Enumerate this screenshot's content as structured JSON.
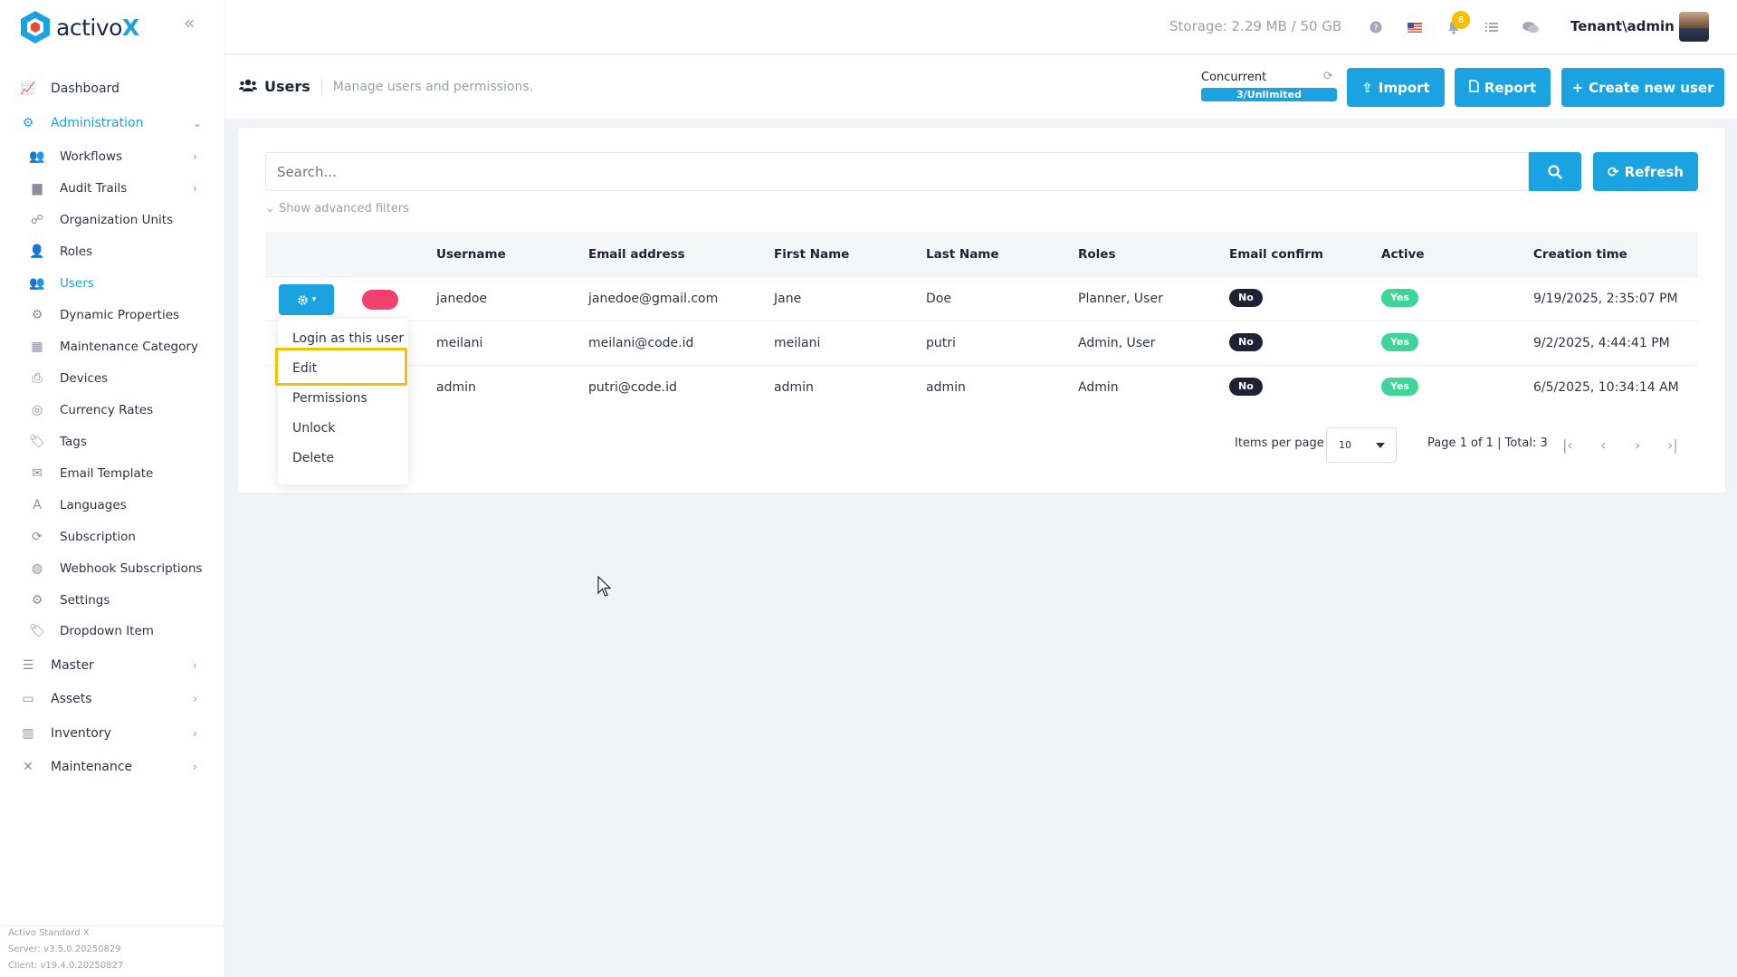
{
  "brand": {
    "name_prefix": "activo",
    "name_suffix": "X",
    "accent": "#1aa3e0"
  },
  "sidebar": {
    "items": [
      {
        "label": "Dashboard",
        "icon": "chart-line-icon",
        "level": "top",
        "active": false,
        "chevron": false
      },
      {
        "label": "Administration",
        "icon": "cogs-icon",
        "level": "top",
        "active": true,
        "chevron": "down"
      },
      {
        "label": "Workflows",
        "icon": "users-icon",
        "level": "sub",
        "active": false,
        "chevron": "right"
      },
      {
        "label": "Audit Trails",
        "icon": "folder-icon",
        "level": "sub",
        "active": false,
        "chevron": "right"
      },
      {
        "label": "Organization Units",
        "icon": "sitemap-icon",
        "level": "sub",
        "active": false,
        "chevron": false
      },
      {
        "label": "Roles",
        "icon": "user-tag-icon",
        "level": "sub",
        "active": false,
        "chevron": false
      },
      {
        "label": "Users",
        "icon": "users-icon",
        "level": "sub",
        "active": true,
        "chevron": false
      },
      {
        "label": "Dynamic Properties",
        "icon": "gear-icon",
        "level": "sub",
        "active": false,
        "chevron": false
      },
      {
        "label": "Maintenance Category",
        "icon": "grid-icon",
        "level": "sub",
        "active": false,
        "chevron": false
      },
      {
        "label": "Devices",
        "icon": "printer-icon",
        "level": "sub",
        "active": false,
        "chevron": false
      },
      {
        "label": "Currency Rates",
        "icon": "coins-icon",
        "level": "sub",
        "active": false,
        "chevron": false
      },
      {
        "label": "Tags",
        "icon": "tags-icon",
        "level": "sub",
        "active": false,
        "chevron": false
      },
      {
        "label": "Email Template",
        "icon": "envelope-icon",
        "level": "sub",
        "active": false,
        "chevron": false
      },
      {
        "label": "Languages",
        "icon": "language-icon",
        "level": "sub",
        "active": false,
        "chevron": false
      },
      {
        "label": "Subscription",
        "icon": "sync-icon",
        "level": "sub",
        "active": false,
        "chevron": false
      },
      {
        "label": "Webhook Subscriptions",
        "icon": "globe-icon",
        "level": "sub",
        "active": false,
        "chevron": false
      },
      {
        "label": "Settings",
        "icon": "gear-icon",
        "level": "sub",
        "active": false,
        "chevron": false
      },
      {
        "label": "Dropdown Item",
        "icon": "tags-icon",
        "level": "sub",
        "active": false,
        "chevron": false
      },
      {
        "label": "Master",
        "icon": "database-icon",
        "level": "top",
        "active": false,
        "chevron": "right"
      },
      {
        "label": "Assets",
        "icon": "laptop-icon",
        "level": "top",
        "active": false,
        "chevron": "right"
      },
      {
        "label": "Inventory",
        "icon": "warehouse-icon",
        "level": "top",
        "active": false,
        "chevron": "right"
      },
      {
        "label": "Maintenance",
        "icon": "tools-icon",
        "level": "top",
        "active": false,
        "chevron": "right"
      }
    ],
    "version": {
      "product": "Activo Standard X",
      "server": "Server: v3.5.0.20250829",
      "client": "Client: v19.4.0.20250827"
    }
  },
  "topbar": {
    "storage": "Storage: 2.29 MB / 50 GB",
    "notification_count": "8",
    "user": "Tenant\\admin"
  },
  "subheader": {
    "title": "Users",
    "description": "Manage users and permissions.",
    "concurrent_label": "Concurrent",
    "concurrent_value": "3/Unlimited",
    "import_label": "Import",
    "report_label": "Report",
    "create_label": "Create new user"
  },
  "filters": {
    "search_placeholder": "Search...",
    "refresh_label": "Refresh",
    "advanced_label": "Show advanced filters"
  },
  "table": {
    "columns": [
      "Username",
      "Email address",
      "First Name",
      "Last Name",
      "Roles",
      "Email confirm",
      "Active",
      "Creation time"
    ],
    "rows": [
      {
        "username": "janedoe",
        "email": "janedoe@gmail.com",
        "first": "Jane",
        "last": "Doe",
        "roles": "Planner, User",
        "email_confirm": "No",
        "active": "Yes",
        "created": "9/19/2025, 2:35:07 PM"
      },
      {
        "username": "meilani",
        "email": "meilani@code.id",
        "first": "meilani",
        "last": "putri",
        "roles": "Admin, User",
        "email_confirm": "No",
        "active": "Yes",
        "created": "9/2/2025, 4:44:41 PM"
      },
      {
        "username": "admin",
        "email": "putri@code.id",
        "first": "admin",
        "last": "admin",
        "roles": "Admin",
        "email_confirm": "No",
        "active": "Yes",
        "created": "6/5/2025, 10:34:14 AM"
      }
    ]
  },
  "row_actions_menu": {
    "items": [
      "Login as this user",
      "Edit",
      "Permissions",
      "Unlock",
      "Delete"
    ],
    "highlighted": "Edit"
  },
  "pagination": {
    "items_per_page_label": "Items per page",
    "items_per_page_value": "10",
    "summary": "Page 1 of 1 | Total: 3"
  }
}
